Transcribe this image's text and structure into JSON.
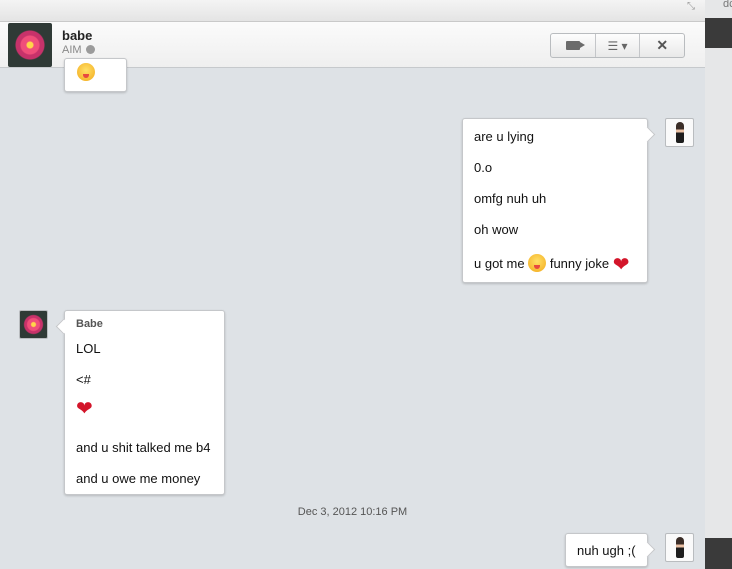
{
  "window": {
    "ghost_text": "dc"
  },
  "contact": {
    "name": "babe",
    "service": "AIM"
  },
  "toolbar": {
    "video_icon": "video-camera-icon",
    "menu_icon": "list-menu-icon",
    "close_icon": "close-icon"
  },
  "messages": {
    "top_partial": {
      "emoji": "tongue-face-emoji"
    },
    "me_block": {
      "lines": [
        "are u lying",
        "0.o",
        "omfg nuh uh",
        "oh wow"
      ],
      "last_pre": "u got me",
      "last_post": "funny joke"
    },
    "babe_block": {
      "sender": "Babe",
      "lines": [
        "LOL",
        "<#"
      ],
      "lines2": [
        "and u shit talked me b4",
        "and u owe me money"
      ]
    },
    "timestamp": "Dec 3, 2012 10:16 PM",
    "me_last": "nuh ugh ;("
  },
  "colors": {
    "heart": "#d3152a",
    "chat_bg": "#dee2e6"
  }
}
